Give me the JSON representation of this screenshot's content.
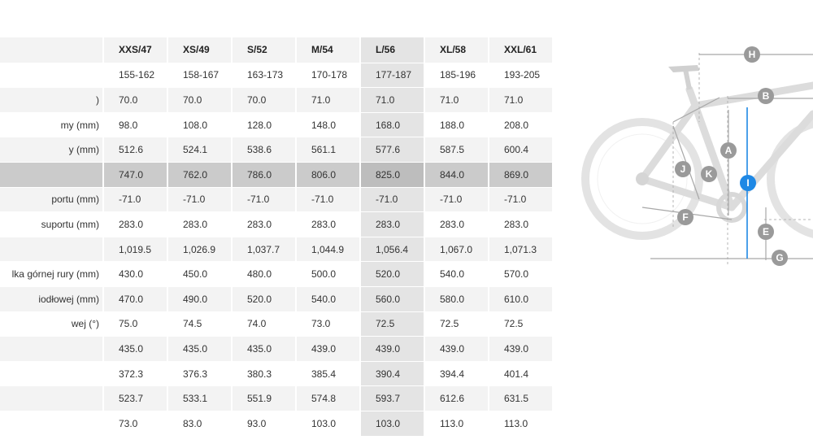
{
  "table": {
    "headers": [
      "",
      "XXS/47",
      "XS/49",
      "S/52",
      "M/54",
      "L/56",
      "XL/58",
      "XXL/61"
    ],
    "rows": [
      {
        "label": "",
        "values": [
          "155-162",
          "158-167",
          "163-173",
          "170-178",
          "177-187",
          "185-196",
          "193-205"
        ]
      },
      {
        "label": ")",
        "values": [
          "70.0",
          "70.0",
          "70.0",
          "71.0",
          "71.0",
          "71.0",
          "71.0"
        ]
      },
      {
        "label": "my (mm)",
        "values": [
          "98.0",
          "108.0",
          "128.0",
          "148.0",
          "168.0",
          "188.0",
          "208.0"
        ]
      },
      {
        "label": "y (mm)",
        "values": [
          "512.6",
          "524.1",
          "538.6",
          "561.1",
          "577.6",
          "587.5",
          "600.4"
        ]
      },
      {
        "label": "",
        "values": [
          "747.0",
          "762.0",
          "786.0",
          "806.0",
          "825.0",
          "844.0",
          "869.0"
        ]
      },
      {
        "label": "portu (mm)",
        "values": [
          "-71.0",
          "-71.0",
          "-71.0",
          "-71.0",
          "-71.0",
          "-71.0",
          "-71.0"
        ]
      },
      {
        "label": "suportu (mm)",
        "values": [
          "283.0",
          "283.0",
          "283.0",
          "283.0",
          "283.0",
          "283.0",
          "283.0"
        ]
      },
      {
        "label": "",
        "values": [
          "1,019.5",
          "1,026.9",
          "1,037.7",
          "1,044.9",
          "1,056.4",
          "1,067.0",
          "1,071.3"
        ]
      },
      {
        "label": "lka górnej rury (mm)",
        "values": [
          "430.0",
          "450.0",
          "480.0",
          "500.0",
          "520.0",
          "540.0",
          "570.0"
        ]
      },
      {
        "label": "iodłowej (mm)",
        "values": [
          "470.0",
          "490.0",
          "520.0",
          "540.0",
          "560.0",
          "580.0",
          "610.0"
        ]
      },
      {
        "label": "wej (°)",
        "values": [
          "75.0",
          "74.5",
          "74.0",
          "73.0",
          "72.5",
          "72.5",
          "72.5"
        ]
      },
      {
        "label": "",
        "values": [
          "435.0",
          "435.0",
          "435.0",
          "439.0",
          "439.0",
          "439.0",
          "439.0"
        ]
      },
      {
        "label": "",
        "values": [
          "372.3",
          "376.3",
          "380.3",
          "385.4",
          "390.4",
          "394.4",
          "401.4"
        ]
      },
      {
        "label": "",
        "values": [
          "523.7",
          "533.1",
          "551.9",
          "574.8",
          "593.7",
          "612.6",
          "631.5"
        ]
      },
      {
        "label": "",
        "values": [
          "73.0",
          "83.0",
          "93.0",
          "103.0",
          "103.0",
          "113.0",
          "113.0"
        ]
      }
    ],
    "selected_column_index": 4,
    "highlighted_row_index": 4
  },
  "diagram": {
    "markers": [
      "H",
      "B",
      "A",
      "J",
      "K",
      "I",
      "F",
      "E",
      "G"
    ],
    "marker_color": "#9a9a9a",
    "active_marker": "I",
    "active_color": "#1e88e5"
  }
}
